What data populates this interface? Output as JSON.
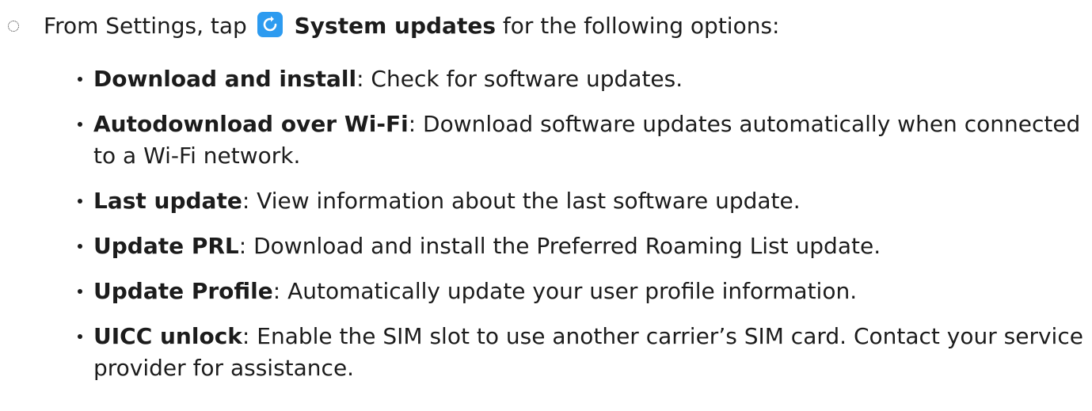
{
  "step": {
    "prefix": "From Settings, tap",
    "icon": "system-updates-icon",
    "icon_color": "#2d9bf0",
    "link": "System updates",
    "suffix": "for the following options:"
  },
  "options": [
    {
      "term": "Download and install",
      "desc": ": Check for software updates."
    },
    {
      "term": "Autodownload over Wi-Fi",
      "desc": ": Download software updates automatically when connected to a Wi-Fi network."
    },
    {
      "term": "Last update",
      "desc": ": View information about the last software update."
    },
    {
      "term": "Update PRL",
      "desc": ": Download and install the Preferred Roaming List update."
    },
    {
      "term": "Update Profile",
      "desc": ": Automatically update your user profile information."
    },
    {
      "term": "UICC unlock",
      "desc": ": Enable the SIM slot to use another carrier’s SIM card. Contact your service provider for assistance."
    }
  ]
}
